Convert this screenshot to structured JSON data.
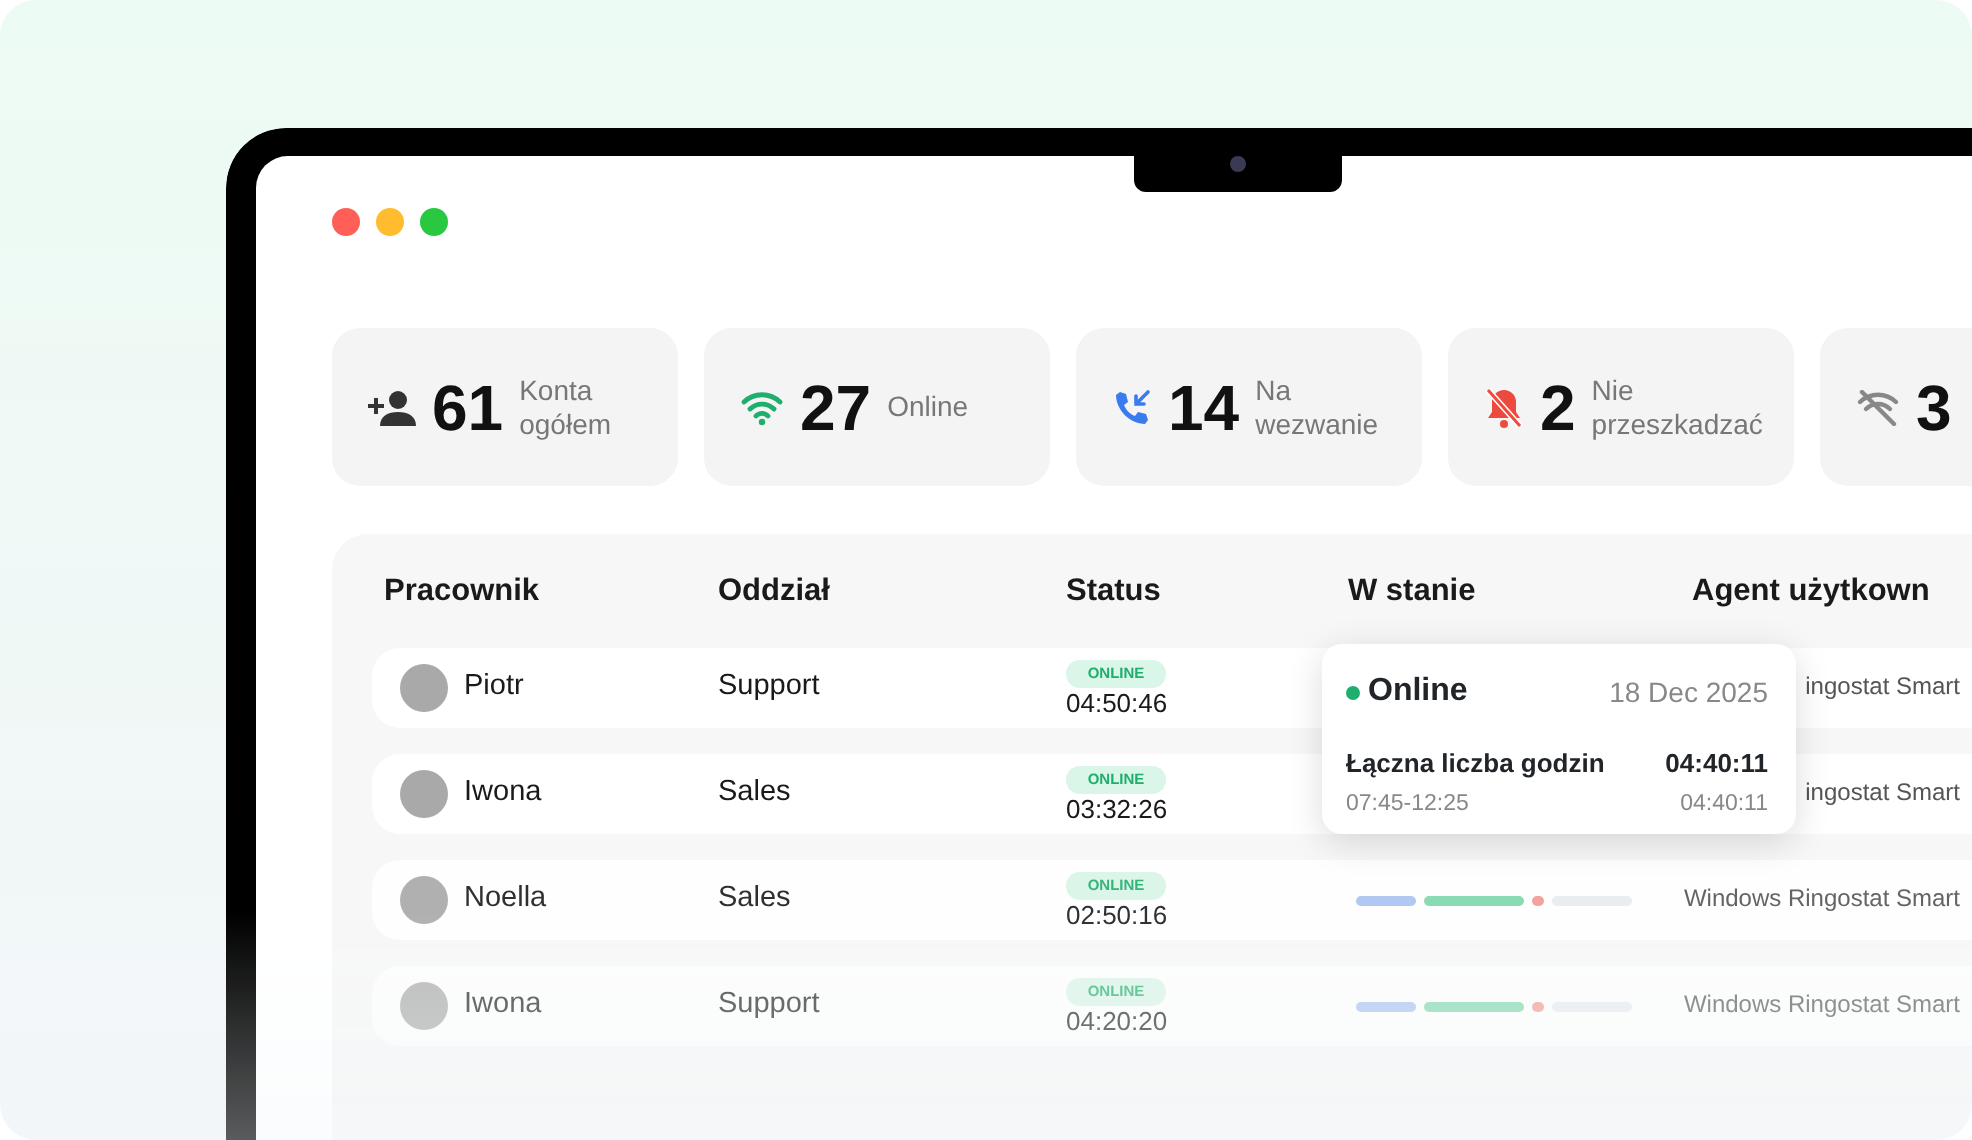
{
  "stats": [
    {
      "kind": "accounts",
      "value": "61",
      "label": [
        "Konta",
        "ogółem"
      ]
    },
    {
      "kind": "online",
      "value": "27",
      "label": [
        "Online"
      ]
    },
    {
      "kind": "oncall",
      "value": "14",
      "label": [
        "Na",
        "wezwanie"
      ]
    },
    {
      "kind": "dnd",
      "value": "2",
      "label": [
        "Nie",
        "przeszkadzać"
      ]
    },
    {
      "kind": "offline",
      "value": "3"
    }
  ],
  "table": {
    "columns": [
      "Pracownik",
      "Oddział",
      "Status",
      "W stanie",
      "Agent użytkown"
    ],
    "rows": [
      {
        "name": "Piotr",
        "department": "Support",
        "status": "ONLINE",
        "time": "04:50:46",
        "agent": "ingostat Smart",
        "timeline": false
      },
      {
        "name": "Iwona",
        "department": "Sales",
        "status": "ONLINE",
        "time": "03:32:26",
        "agent": "ingostat Smart",
        "timeline": false
      },
      {
        "name": "Noella",
        "department": "Sales",
        "status": "ONLINE",
        "time": "02:50:16",
        "agent": "Windows Ringostat Smart",
        "timeline": true
      },
      {
        "name": "Iwona",
        "department": "Support",
        "status": "ONLINE",
        "time": "04:20:20",
        "agent": "Windows Ringostat Smart",
        "timeline": true
      }
    ]
  },
  "tooltip": {
    "status": "Online",
    "date": "18 Dec 2025",
    "total_label": "Łączna liczba godzin",
    "total": "04:40:11",
    "range": "07:45-12:25",
    "range_total": "04:40:11"
  }
}
